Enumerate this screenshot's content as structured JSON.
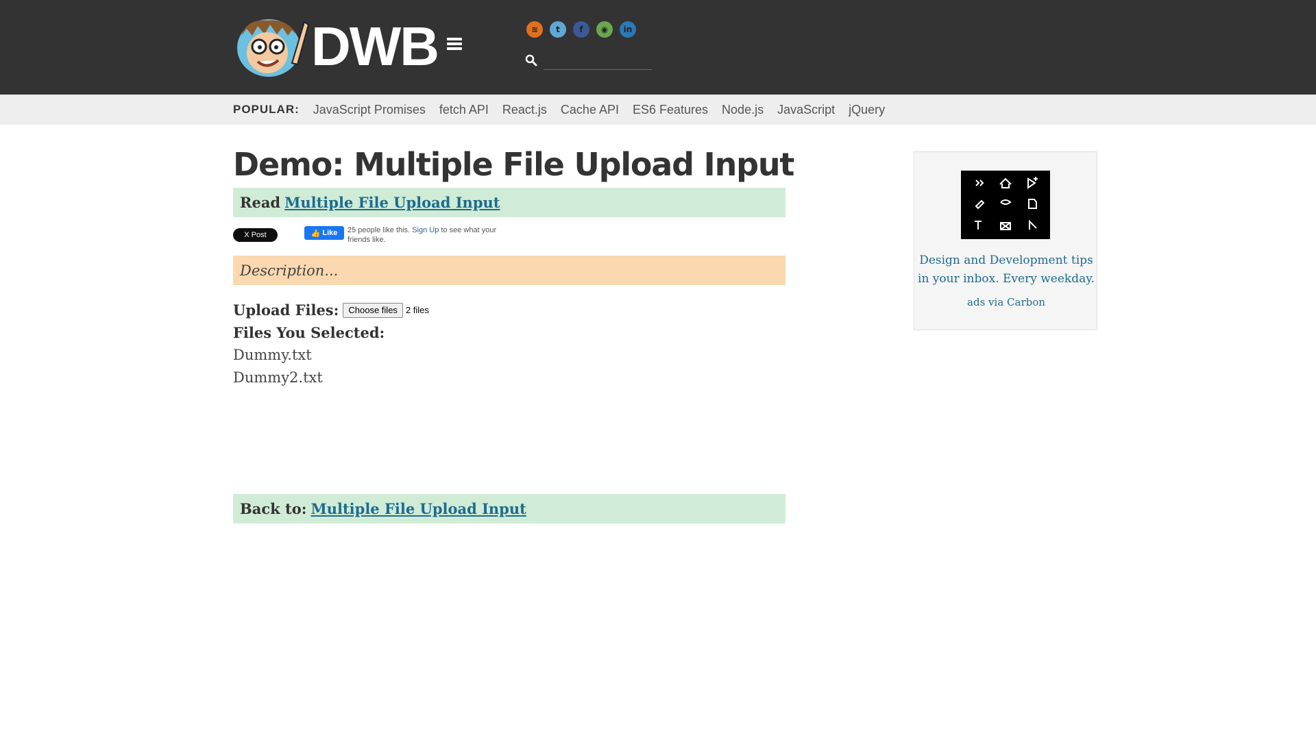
{
  "header": {
    "logo_text": "DWB",
    "social_icons": [
      {
        "name": "rss-icon",
        "glyph": "≋",
        "color": "#e07020"
      },
      {
        "name": "twitter-icon",
        "glyph": "t",
        "color": "#5fa8d3"
      },
      {
        "name": "facebook-icon",
        "glyph": "f",
        "color": "#3b5998"
      },
      {
        "name": "github-icon",
        "glyph": "◉",
        "color": "#6aa84f"
      },
      {
        "name": "linkedin-icon",
        "glyph": "in",
        "color": "#2a7ab8"
      }
    ],
    "search_value": ""
  },
  "popular": {
    "label": "POPULAR:",
    "links": [
      "JavaScript Promises",
      "fetch API",
      "React.js",
      "Cache API",
      "ES6 Features",
      "Node.js",
      "JavaScript",
      "jQuery"
    ]
  },
  "main": {
    "title": "Demo: Multiple File Upload Input",
    "read_label": "Read",
    "read_link": "Multiple File Upload Input",
    "x_post": "X Post",
    "fb_like": "Like",
    "fb_text_count": "25 people like this.",
    "fb_signup": "Sign Up",
    "fb_text_rest": "to see what your friends like.",
    "description": "Description...",
    "upload_label": "Upload Files:",
    "choose_button": "Choose files",
    "file_count": "2 files",
    "selected_label": "Files You Selected:",
    "files": [
      "Dummy.txt",
      "Dummy2.txt"
    ],
    "back_label": "Back to:",
    "back_link": "Multiple File Upload Input"
  },
  "ad": {
    "text": "Design and Development tips in your inbox. Every weekday.",
    "via": "ads via Carbon"
  }
}
